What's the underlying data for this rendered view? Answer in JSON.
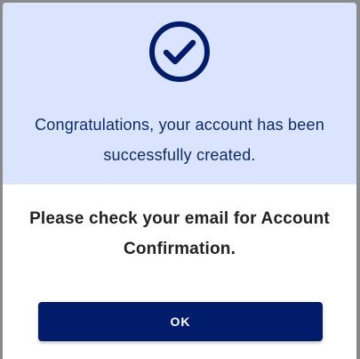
{
  "dialog": {
    "success_message": "Congratulations, your account has been successfully created.",
    "instruction_message": "Please check your email for Account Confirmation.",
    "ok_label": "OK",
    "icon": "check-circle-icon"
  },
  "colors": {
    "header_background": "#dbe4ff",
    "primary": "#001c6b",
    "success_text": "#0d2a6b",
    "body_text": "#222222",
    "overlay": "#8a8a8a"
  }
}
